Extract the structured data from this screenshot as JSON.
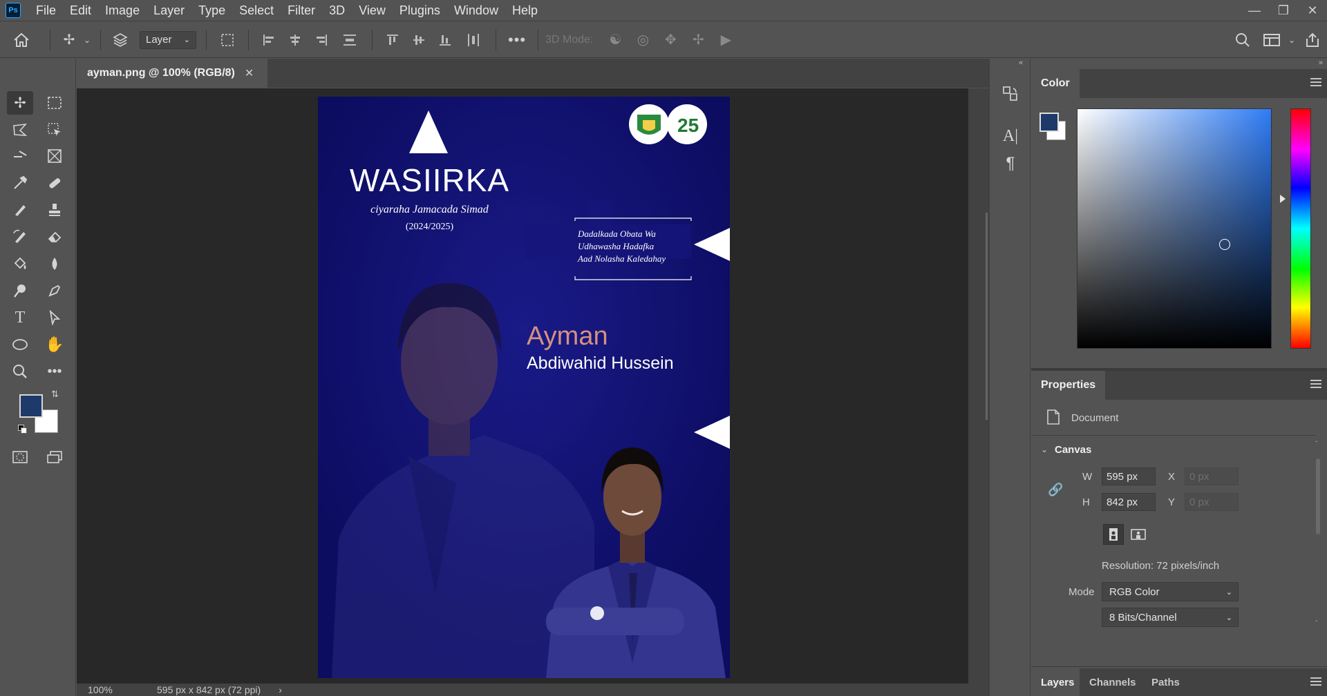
{
  "app": {
    "logo": "Ps"
  },
  "menu": [
    "File",
    "Edit",
    "Image",
    "Layer",
    "Type",
    "Select",
    "Filter",
    "3D",
    "View",
    "Plugins",
    "Window",
    "Help"
  ],
  "options": {
    "layer_select": "Layer",
    "mode_3d_label": "3D Mode:"
  },
  "document": {
    "tab_title": "ayman.png @ 100% (RGB/8)",
    "zoom": "100%",
    "doc_info": "595 px x 842 px (72 ppi)"
  },
  "poster": {
    "title": "WASIIRKA",
    "subtitle": "ciyaraha Jamacada Simad",
    "years": "(2024/2025)",
    "slogan": [
      "Dadalkada Obata Wa",
      "Udhawasha Hadafka",
      "Aad Nolasha Kaledahay"
    ],
    "first_name": "Ayman",
    "full_name": "Abdiwahid Hussein",
    "badge_number": "25",
    "colors": {
      "background": "#0f0f6b",
      "accent_name": "#d4917f"
    }
  },
  "color_panel": {
    "tab": "Color",
    "foreground": "#1d3a6a",
    "background": "#ffffff"
  },
  "properties": {
    "tab": "Properties",
    "kind": "Document",
    "section": "Canvas",
    "w_label": "W",
    "h_label": "H",
    "x_label": "X",
    "y_label": "Y",
    "width": "595 px",
    "height": "842 px",
    "x_placeholder": "0 px",
    "y_placeholder": "0 px",
    "resolution": "Resolution: 72 pixels/inch",
    "mode_label": "Mode",
    "mode": "RGB Color",
    "bits": "8 Bits/Channel"
  },
  "layers_tabs": [
    "Layers",
    "Channels",
    "Paths"
  ]
}
